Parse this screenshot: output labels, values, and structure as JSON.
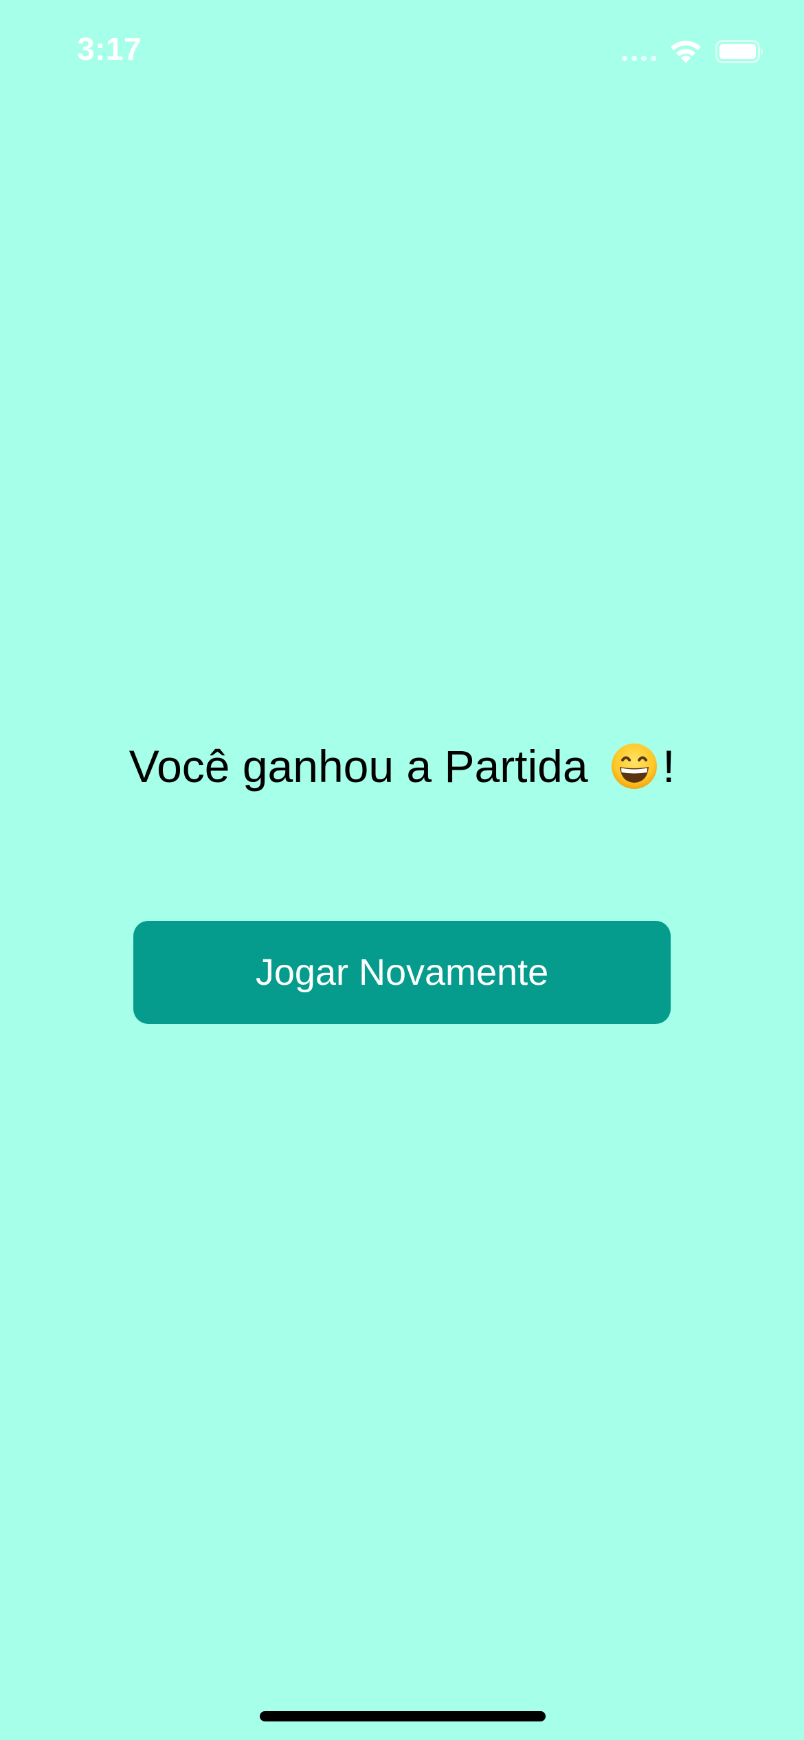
{
  "status_bar": {
    "time": "3:17",
    "wifi_icon": "wifi-icon",
    "battery_icon": "battery-icon",
    "signal_icon": "cellular-signal-icon"
  },
  "main": {
    "result_text_before": "Você ganhou a Partida",
    "result_emoji_icon": "grinning-face-icon",
    "result_text_after": "!",
    "play_again_label": "Jogar Novamente"
  },
  "colors": {
    "background": "#a6ffe8",
    "button": "#059c8d",
    "button_text": "#ffffff",
    "text": "#000000"
  }
}
